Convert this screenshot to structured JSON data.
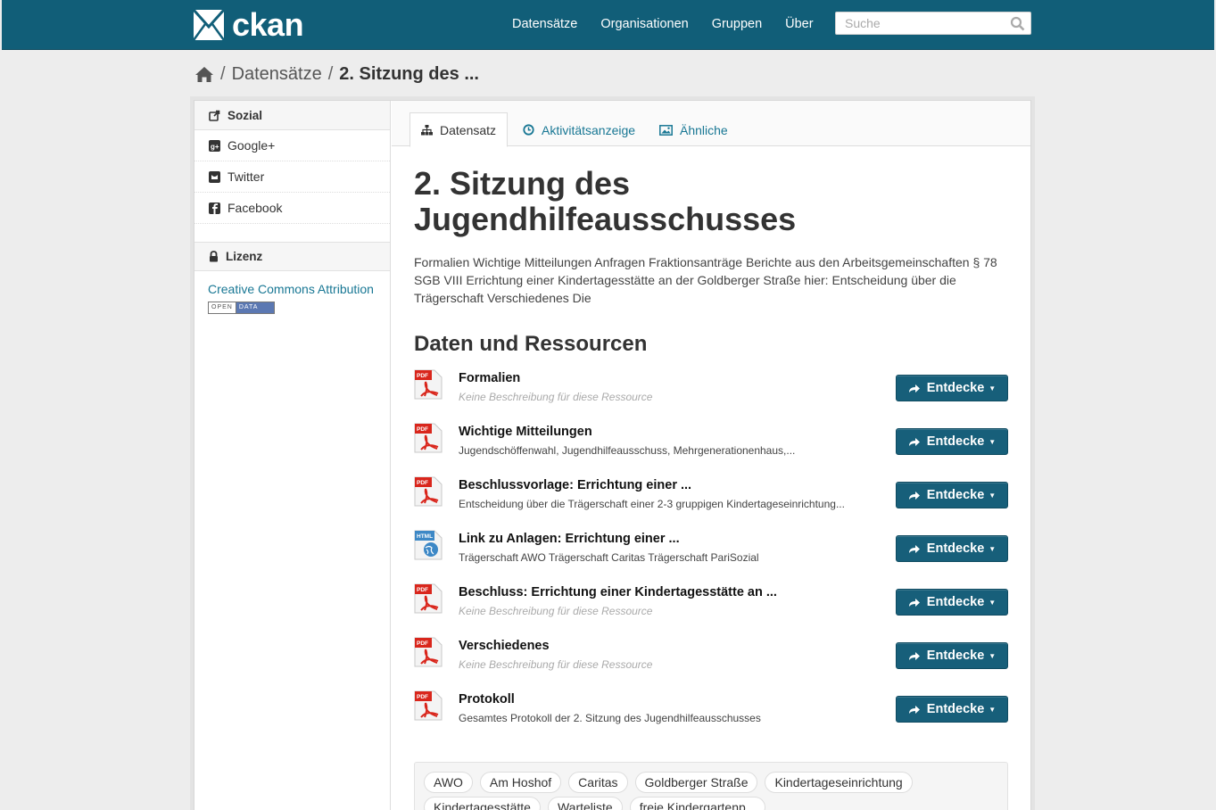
{
  "brand": {
    "name": "ckan"
  },
  "nav": [
    "Datensätze",
    "Organisationen",
    "Gruppen",
    "Über"
  ],
  "search": {
    "placeholder": "Suche",
    "value": ""
  },
  "breadcrumb": {
    "items": [
      "Datensätze"
    ],
    "current": "2. Sitzung des ..."
  },
  "aside": {
    "social_heading": "Sozial",
    "social": [
      "Google+",
      "Twitter",
      "Facebook"
    ],
    "license_heading": "Lizenz",
    "license_link": "Creative Commons Attribution",
    "badge": {
      "open": "OPEN",
      "data": "DATA"
    }
  },
  "tabs": [
    "Datensatz",
    "Aktivitätsanzeige",
    "Ähnliche"
  ],
  "dataset": {
    "title": "2. Sitzung des Jugendhilfeausschusses",
    "notes": "Formalien Wichtige Mitteilungen Anfragen Fraktionsanträge Berichte aus den Arbeitsgemeinschaften § 78 SGB VIII Errichtung einer Kindertagesstätte an der Goldberger Straße hier: Entscheidung über die Trägerschaft Verschiedenes Die"
  },
  "resources_heading": "Daten und Ressourcen",
  "explore_label": "Entdecke",
  "resources": [
    {
      "format": "PDF",
      "title": "Formalien",
      "description": "Keine Beschreibung für diese Ressource",
      "empty": true
    },
    {
      "format": "PDF",
      "title": "Wichtige Mitteilungen",
      "description": "Jugendschöffenwahl, Jugendhilfeausschuss, Mehrgenerationenhaus,...",
      "empty": false
    },
    {
      "format": "PDF",
      "title": "Beschlussvorlage: Errichtung einer ...",
      "description": "Entscheidung über die Trägerschaft einer 2-3 gruppigen Kindertageseinrichtung...",
      "empty": false
    },
    {
      "format": "HTML",
      "title": "Link zu Anlagen: Errichtung einer ...",
      "description": "Trägerschaft AWO Trägerschaft Caritas Trägerschaft PariSozial",
      "empty": false
    },
    {
      "format": "PDF",
      "title": "Beschluss: Errichtung einer Kindertagesstätte an ...",
      "description": "Keine Beschreibung für diese Ressource",
      "empty": true
    },
    {
      "format": "PDF",
      "title": "Verschiedenes",
      "description": "Keine Beschreibung für diese Ressource",
      "empty": true
    },
    {
      "format": "PDF",
      "title": "Protokoll",
      "description": "Gesamtes Protokoll der 2. Sitzung des Jugendhilfeausschusses",
      "empty": false
    }
  ],
  "tags": [
    "AWO",
    "Am Hoshof",
    "Caritas",
    "Goldberger Straße",
    "Kindertageseinrichtung",
    "Kindertagesstätte",
    "Warteliste",
    "freie Kindergartenp..."
  ],
  "colors": {
    "masthead": "#115e78",
    "button": "#175f7a",
    "link": "#187794",
    "pdf": "#d9261c",
    "html": "#3d88c6"
  }
}
